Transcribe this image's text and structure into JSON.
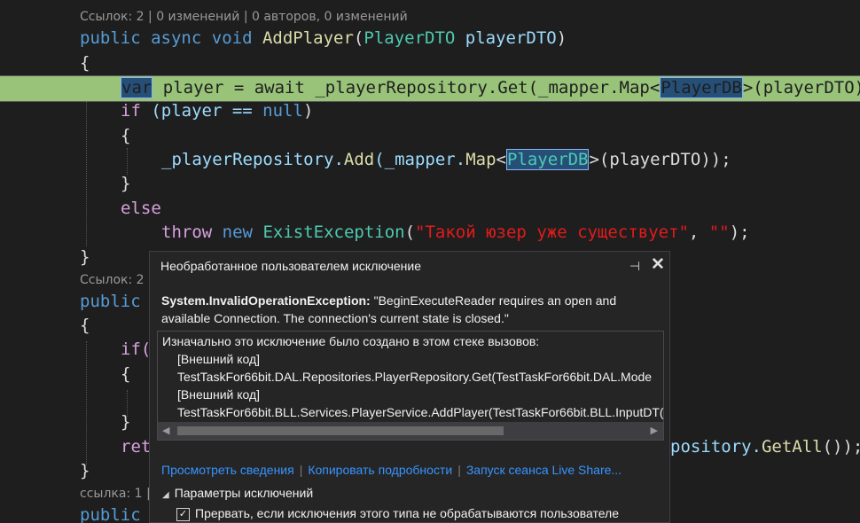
{
  "codelens": {
    "ref1": "Ссылок: 2 | 0 изменений | 0 авторов, 0 изменений",
    "ref2": "Ссылок: 2",
    "ref3": "ссылка: 1 |"
  },
  "code": {
    "l1_public": "public",
    "l1_async": "async",
    "l1_void": "void",
    "l1_method": "AddPlayer",
    "l1_paren_open": "(",
    "l1_type": "PlayerDTO",
    "l1_param": "playerDTO",
    "l1_paren_close": ")",
    "brace_open": "{",
    "brace_close": "}",
    "l3_var": "var",
    "l3_rest_a": " player = await _playerRepository.",
    "l3_get": "Get",
    "l3_rest_b": "(_mapper.",
    "l3_map": "Map",
    "l3_lt": "<",
    "l3_type": "PlayerDB",
    "l3_rest_c": ">(playerDTO)",
    "l4_if": "if",
    "l4_rest": " (player == ",
    "l4_null": "null",
    "l4_close": ")",
    "l6_a": "_playerRepository.",
    "l6_add": "Add",
    "l6_b": "(_mapper.",
    "l6_map": "Map",
    "l6_lt": "<",
    "l6_type": "PlayerDB",
    "l6_c": ">(playerDTO));",
    "l8_else": "else",
    "l9_throw": "throw",
    "l9_new": "new",
    "l9_type": "ExistException",
    "l9_open": "(",
    "l9_str": "\"Такой юзер уже существует\"",
    "l9_comma": ", ",
    "l9_str2": "\"\"",
    "l9_close": ");",
    "l11_public": "public",
    "l13_if": "if(",
    "l16_ret": "ret",
    "l16_tail_a": "pository.",
    "l16_getall": "GetAll",
    "l16_tail_b": "());",
    "l19_public": "public"
  },
  "popup": {
    "title": "Необработанное пользователем исключение",
    "pin_icon": "⊣",
    "close_icon": "✕",
    "exception_type": "System.InvalidOperationException:",
    "exception_text": " \"BeginExecuteReader requires an open and available Connection. The connection's current state is closed.\"",
    "stack_header": "Изначально это исключение было создано в этом стеке вызовов:",
    "stack": [
      "[Внешний код]",
      "TestTaskFor66bit.DAL.Repositories.PlayerRepository.Get(TestTaskFor66bit.DAL.Mode",
      "[Внешний код]",
      "TestTaskFor66bit.BLL.Services.PlayerService.AddPlayer(TestTaskFor66bit.BLL.InputDT("
    ],
    "links": {
      "view_details": "Просмотреть сведения",
      "copy_details": "Копировать подробности",
      "live_share": "Запуск сеанса Live Share..."
    },
    "params_label": "Параметры исключений",
    "break_label": "Прервать, если исключения этого типа не обрабатываются пользователе",
    "break_checked": "✓"
  },
  "colors": {
    "background": "#1e1e1e",
    "highlight": "#98c379",
    "keyword": "#569cd6",
    "type": "#4ec9b0",
    "method": "#dcdcaa",
    "string": "#e21b1b",
    "link": "#3794ff"
  }
}
